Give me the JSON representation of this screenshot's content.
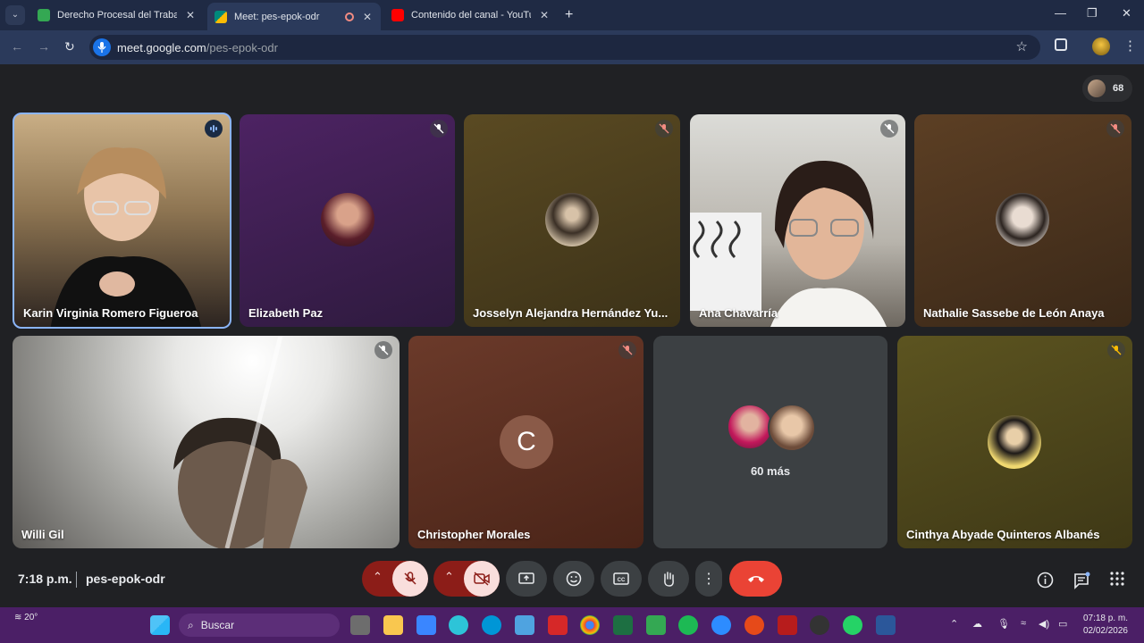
{
  "browser": {
    "tabs": [
      {
        "title": "Derecho Procesal del Trabajo I",
        "favicon_color": "#34a853"
      },
      {
        "title": "Meet: pes-epok-odr",
        "favicon_color": "#00897b",
        "active": true
      },
      {
        "title": "Contenido del canal - YouTube",
        "favicon_color": "#ff0000"
      }
    ],
    "url_host": "meet.google.com",
    "url_path": "/pes-epok-odr"
  },
  "meet": {
    "participant_count": "68",
    "tiles": [
      {
        "name": "Karin Virginia Romero Figueroa"
      },
      {
        "name": "Elizabeth Paz"
      },
      {
        "name": "Josselyn Alejandra Hernández Yu..."
      },
      {
        "name": "Ana Chavarría"
      },
      {
        "name": "Nathalie Sassebe de León Anaya"
      },
      {
        "name": "Willi Gil"
      },
      {
        "name": "Christopher Morales",
        "initial": "C"
      },
      {
        "name": "60 más"
      },
      {
        "name": "Cinthya Abyade Quinteros Albanés"
      }
    ],
    "clock": "7:18 p.m.",
    "meeting_code": "pes-epok-odr"
  },
  "taskbar": {
    "weather": "20°",
    "search_label": "Buscar",
    "time": "07:18 p. m.",
    "date": "02/02/2026"
  },
  "colors": {
    "end_call": "#ea4335",
    "mic_off_bg": "#f9dedc",
    "accent_blue": "#8ab4f8"
  }
}
